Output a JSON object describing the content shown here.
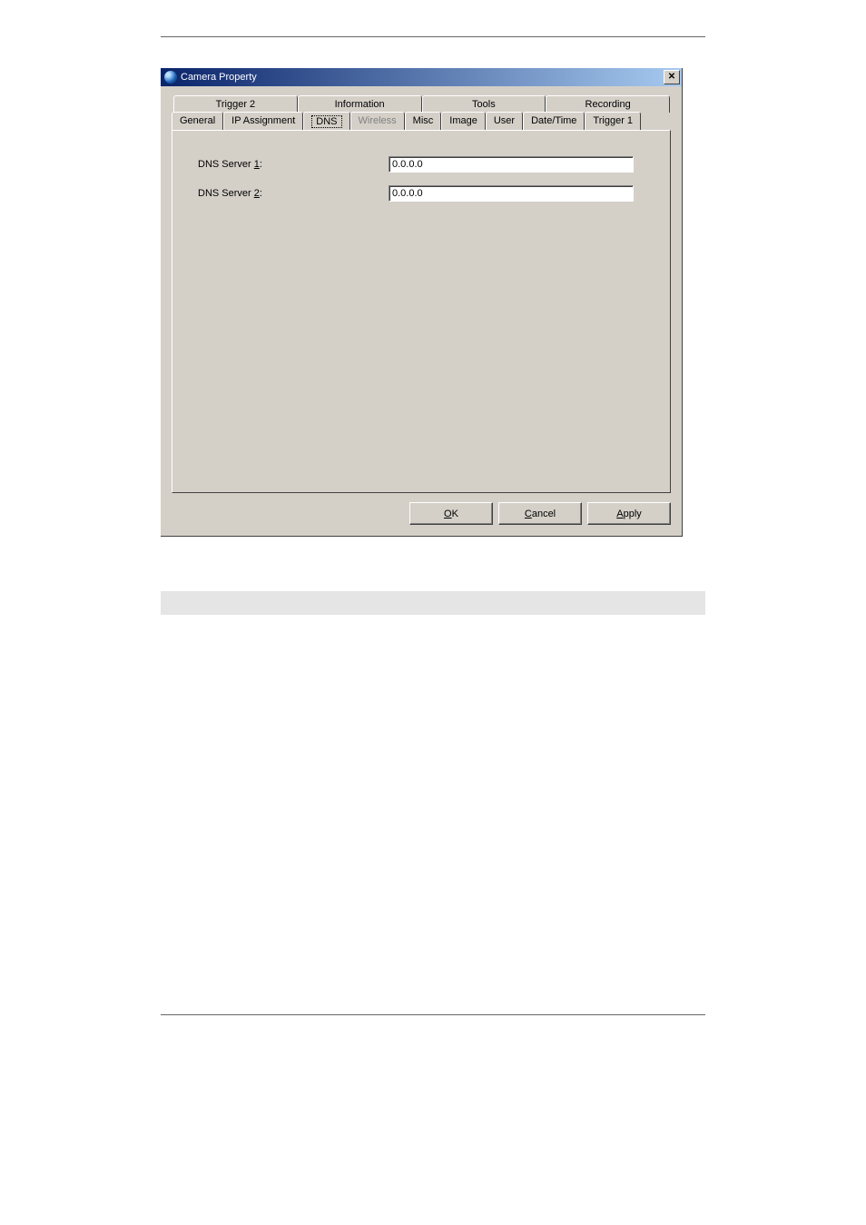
{
  "window": {
    "title": "Camera Property"
  },
  "tabs": {
    "row_back": [
      {
        "label": "Trigger 2"
      },
      {
        "label": "Information"
      },
      {
        "label": "Tools"
      },
      {
        "label": "Recording"
      }
    ],
    "row_front": [
      {
        "label": "General",
        "state": "normal"
      },
      {
        "label": "IP Assignment",
        "state": "normal"
      },
      {
        "label": "DNS",
        "state": "selected"
      },
      {
        "label": "Wireless",
        "state": "disabled"
      },
      {
        "label": "Misc",
        "state": "normal"
      },
      {
        "label": "Image",
        "state": "normal"
      },
      {
        "label": "User",
        "state": "normal"
      },
      {
        "label": "Date/Time",
        "state": "normal"
      },
      {
        "label": "Trigger 1",
        "state": "normal"
      }
    ]
  },
  "form": {
    "dns1": {
      "label_prefix": "DNS Server ",
      "accel": "1",
      "label_suffix": ":",
      "value": "0.0.0.0"
    },
    "dns2": {
      "label_prefix": "DNS Server ",
      "accel": "2",
      "label_suffix": ":",
      "value": "0.0.0.0"
    }
  },
  "buttons": {
    "ok": {
      "accel": "O",
      "rest": "K"
    },
    "cancel": {
      "accel": "C",
      "rest": "ancel"
    },
    "apply": {
      "accel": "A",
      "rest": "pply"
    }
  }
}
